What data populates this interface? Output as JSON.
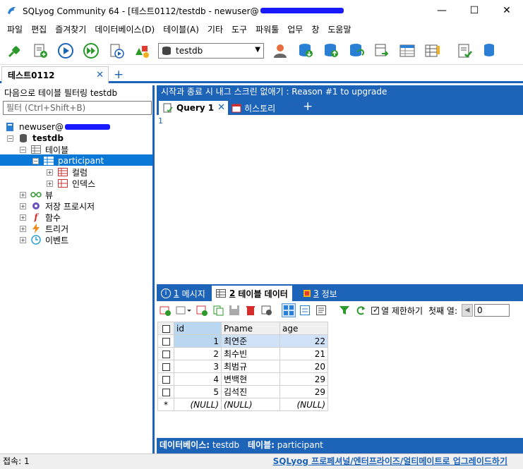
{
  "window": {
    "title": "SQLyog Community 64 - [테스트0112/testdb - newuser@",
    "minimize": "—",
    "maximize": "☐",
    "close": "✕"
  },
  "menu": [
    "파일",
    "편집",
    "즐겨찾기",
    "데이터베이스(D)",
    "테이블(A)",
    "기타",
    "도구",
    "파워툴",
    "업무",
    "창",
    "도움말"
  ],
  "toolbar": {
    "database_selected": "testdb"
  },
  "connection_tab": {
    "label": "테스트0112",
    "close": "✕",
    "new": "+"
  },
  "left": {
    "filter_label": "다음으로 테이블 필터링 testdb",
    "filter_placeholder": "필터 (Ctrl+Shift+B)",
    "connection": "newuser@",
    "database": "testdb",
    "tables_folder": "테이블",
    "table": "participant",
    "columns": "컬럼",
    "indexes": "인덱스",
    "views": "뷰",
    "procs": "저장 프로시저",
    "functions": "함수",
    "triggers": "트리거",
    "events": "이벤트"
  },
  "upgrade_bar": "시작과 종료 시 내그 스크린 없애기 : Reason #1 to upgrade",
  "query_tabs": {
    "query": "Query 1",
    "close": "✕",
    "history": "히스토리",
    "new": "+"
  },
  "editor": {
    "line1": "1"
  },
  "result_tabs": [
    {
      "num": "1",
      "label": "메시지"
    },
    {
      "num": "2",
      "label": "테이블 데이터"
    },
    {
      "num": "3",
      "label": "정보"
    }
  ],
  "result_toolbar": {
    "limit_label": "열 제한하기",
    "first_row_label": "첫째 열:",
    "first_row_value": "0"
  },
  "grid": {
    "columns": [
      "id",
      "Pname",
      "age"
    ],
    "rows": [
      {
        "id": "1",
        "Pname": "최연준",
        "age": "22"
      },
      {
        "id": "2",
        "Pname": "최수빈",
        "age": "21"
      },
      {
        "id": "3",
        "Pname": "최범규",
        "age": "20"
      },
      {
        "id": "4",
        "Pname": "변백현",
        "age": "29"
      },
      {
        "id": "5",
        "Pname": "김석진",
        "age": "29"
      }
    ],
    "new_row_marker": "*",
    "null": "(NULL)"
  },
  "bottom_info": {
    "db_label": "데이터베이스:",
    "db": "testdb",
    "table_label": "테이블:",
    "table": "participant"
  },
  "status": {
    "left": "접속: 1",
    "right": "SQLyog 프로페셔널/엔터프라이즈/얼티메이트로 업그레이드하기"
  }
}
